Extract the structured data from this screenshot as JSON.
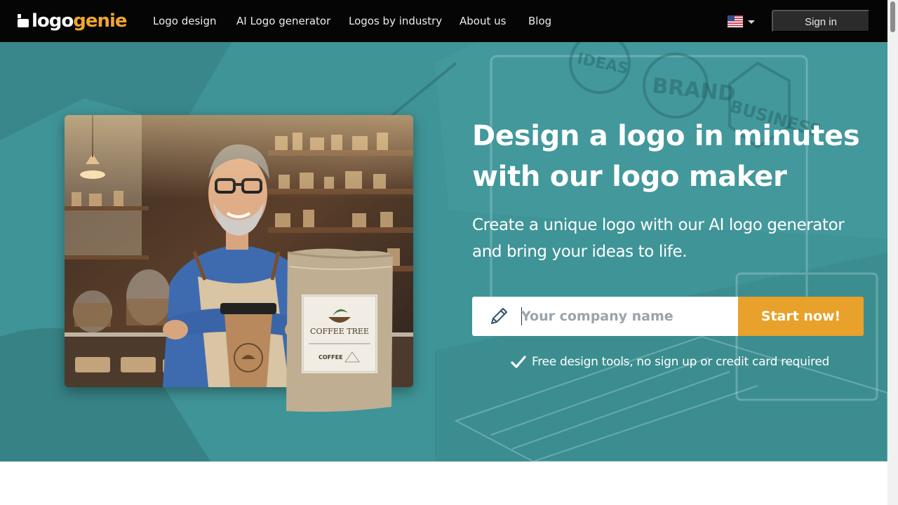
{
  "brand": {
    "name_part1": "logo",
    "name_part2": "genie",
    "accent_color": "#f0a630"
  },
  "nav": {
    "links": [
      {
        "label": "Logo design"
      },
      {
        "label": "AI Logo generator"
      },
      {
        "label": "Logos by industry"
      },
      {
        "label": "About us"
      },
      {
        "label": "Blog"
      }
    ],
    "language_icon": "us-flag-icon",
    "signin_label": "Sign in"
  },
  "hero": {
    "background_color": "#3e9396",
    "headline": "Design a logo in minutes with our logo maker",
    "subheadline": "Create a unique logo with our AI logo generator and bring your ideas to life.",
    "input": {
      "placeholder": "Your company name",
      "value": "",
      "icon": "pencil-icon"
    },
    "cta_label": "Start now!",
    "cta_color": "#e8a12a",
    "note_icon": "checkmark-icon",
    "note": "Free design tools, no sign up or credit card required",
    "photo_alt": "Smiling shop owner with coffee cup and coffee bag",
    "bag_brand": "COFFEE TREE",
    "bag_label": "COFFEE"
  }
}
